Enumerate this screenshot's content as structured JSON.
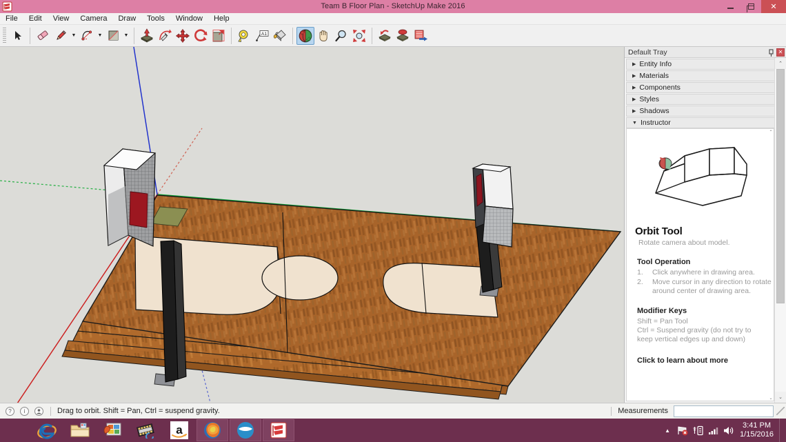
{
  "window": {
    "title": "Team B Floor Plan - SketchUp Make 2016",
    "app_icon": "sketchup-logo-icon",
    "minimize_label": "Minimize",
    "maximize_label": "Maximize",
    "close_label": "✕",
    "titlebar_color": "#dd7fa5",
    "close_color": "#cb5055"
  },
  "menubar": {
    "items": [
      {
        "label": "File"
      },
      {
        "label": "Edit"
      },
      {
        "label": "View"
      },
      {
        "label": "Camera"
      },
      {
        "label": "Draw"
      },
      {
        "label": "Tools"
      },
      {
        "label": "Window"
      },
      {
        "label": "Help"
      }
    ]
  },
  "toolbar": {
    "groups": [
      {
        "buttons": [
          {
            "name": "select-tool",
            "icon": "arrow-cursor-icon",
            "tooltip": "Select",
            "active": false,
            "dropdown": false
          }
        ]
      },
      {
        "buttons": [
          {
            "name": "eraser-tool",
            "icon": "eraser-icon",
            "tooltip": "Eraser",
            "active": false,
            "dropdown": false
          },
          {
            "name": "line-tool",
            "icon": "pencil-icon",
            "tooltip": "Line",
            "active": false,
            "dropdown": true
          },
          {
            "name": "arc-tool",
            "icon": "arc-icon",
            "tooltip": "Arc",
            "active": false,
            "dropdown": true
          },
          {
            "name": "rectangle-tool",
            "icon": "rectangle-icon",
            "tooltip": "Rectangle",
            "active": false,
            "dropdown": true
          }
        ]
      },
      {
        "buttons": [
          {
            "name": "pushpull-tool",
            "icon": "push-pull-icon",
            "tooltip": "Push/Pull",
            "active": false,
            "dropdown": false
          },
          {
            "name": "followme-tool",
            "icon": "follow-me-icon",
            "tooltip": "Follow Me",
            "active": false,
            "dropdown": false
          },
          {
            "name": "move-tool",
            "icon": "move-arrows-icon",
            "tooltip": "Move",
            "active": false,
            "dropdown": false
          },
          {
            "name": "rotate-tool",
            "icon": "rotate-icon",
            "tooltip": "Rotate",
            "active": false,
            "dropdown": false
          },
          {
            "name": "scale-tool",
            "icon": "scale-icon",
            "tooltip": "Scale",
            "active": false,
            "dropdown": false
          }
        ]
      },
      {
        "buttons": [
          {
            "name": "tape-measure-tool",
            "icon": "tape-measure-icon",
            "tooltip": "Tape Measure",
            "active": false,
            "dropdown": false
          },
          {
            "name": "text-tool",
            "icon": "text-a1-icon",
            "tooltip": "Text",
            "active": false,
            "dropdown": false
          },
          {
            "name": "paint-bucket-tool",
            "icon": "paint-bucket-icon",
            "tooltip": "Paint Bucket",
            "active": false,
            "dropdown": false
          }
        ]
      },
      {
        "buttons": [
          {
            "name": "orbit-tool",
            "icon": "orbit-icon",
            "tooltip": "Orbit",
            "active": true,
            "dropdown": false
          },
          {
            "name": "pan-tool",
            "icon": "hand-pan-icon",
            "tooltip": "Pan",
            "active": false,
            "dropdown": false
          },
          {
            "name": "zoom-tool",
            "icon": "magnifier-icon",
            "tooltip": "Zoom",
            "active": false,
            "dropdown": false
          },
          {
            "name": "zoom-extents-tool",
            "icon": "zoom-extents-icon",
            "tooltip": "Zoom Extents",
            "active": false,
            "dropdown": false
          }
        ]
      },
      {
        "buttons": [
          {
            "name": "previous-view-button",
            "icon": "previous-view-icon",
            "tooltip": "Previous",
            "active": false,
            "dropdown": false
          },
          {
            "name": "next-view-button",
            "icon": "next-view-icon",
            "tooltip": "Next",
            "active": false,
            "dropdown": false
          },
          {
            "name": "3d-warehouse-button",
            "icon": "warehouse-icon",
            "tooltip": "3D Warehouse",
            "active": false,
            "dropdown": false
          }
        ]
      }
    ]
  },
  "tray": {
    "title": "Default Tray",
    "pin_icon": "pin-icon",
    "close_label": "✕",
    "panels": [
      {
        "label": "Entity Info",
        "expanded": false,
        "close": "✕"
      },
      {
        "label": "Materials",
        "expanded": false,
        "close": "✕"
      },
      {
        "label": "Components",
        "expanded": false,
        "close": "✕"
      },
      {
        "label": "Styles",
        "expanded": false,
        "close": "✕"
      },
      {
        "label": "Shadows",
        "expanded": false,
        "close": "✕"
      },
      {
        "label": "Instructor",
        "expanded": true,
        "close": "✕"
      }
    ],
    "instructor": {
      "thumbnail_icon": "house-orbit-diagram-icon",
      "title": "Orbit Tool",
      "subtitle": "Rotate camera about model.",
      "operation_heading": "Tool Operation",
      "steps": [
        {
          "num": "1.",
          "text": "Click anywhere in drawing area."
        },
        {
          "num": "2.",
          "text": "Move cursor in any direction to rotate around center of drawing area."
        }
      ],
      "modifier_heading": "Modifier Keys",
      "modifier_lines": [
        "Shift = Pan Tool",
        "Ctrl = Suspend gravity (do not try to keep vertical edges up and down)"
      ],
      "learn_more": "Click to learn about more"
    },
    "scroll_up": "⌃",
    "scroll_down": "⌄"
  },
  "statusbar": {
    "icons": [
      {
        "name": "context-help-icon",
        "glyph": "?"
      },
      {
        "name": "info-icon",
        "glyph": "i"
      },
      {
        "name": "account-icon",
        "glyph": "●"
      }
    ],
    "message": "Drag to orbit. Shift = Pan, Ctrl = suspend gravity.",
    "measurements_label": "Measurements",
    "measurements_value": "",
    "measurements_placeholder": ""
  },
  "taskbar": {
    "start_icon": "windows-start-icon",
    "items": [
      {
        "name": "internet-explorer",
        "icon": "ie-icon",
        "running": false
      },
      {
        "name": "file-explorer",
        "icon": "folder-icon",
        "running": false
      },
      {
        "name": "photo-gallery",
        "icon": "photos-icon",
        "running": false
      },
      {
        "name": "movie-maker",
        "icon": "film-icon",
        "running": false
      },
      {
        "name": "amazon",
        "icon": "amazon-a-icon",
        "running": false
      },
      {
        "name": "firefox",
        "icon": "firefox-icon",
        "running": true
      },
      {
        "name": "openoffice",
        "icon": "openoffice-icon",
        "running": true
      },
      {
        "name": "sketchup",
        "icon": "sketchup-icon",
        "running": true
      }
    ],
    "tray_icons": [
      {
        "name": "show-hidden-icons",
        "glyph": "▲"
      },
      {
        "name": "network-warning-icon",
        "glyph": "flag"
      },
      {
        "name": "action-center-icon",
        "glyph": "center"
      },
      {
        "name": "signal-icon",
        "glyph": "bars"
      },
      {
        "name": "volume-icon",
        "glyph": "speaker"
      }
    ],
    "clock_time": "3:41 PM",
    "clock_date": "1/15/2016"
  },
  "canvas": {
    "background_color": "#dcdcd8",
    "model_name": "basketball-court-model",
    "axes": {
      "red_label": "red-axis",
      "green_label": "green-axis",
      "blue_label": "blue-axis",
      "red_color": "#cc2222",
      "green_color": "#11aa33",
      "blue_color": "#2233cc"
    },
    "floor_color": "#a8642a",
    "paint_color": "#f0e2cf",
    "court_elements": [
      "wood-floor",
      "left-key-area",
      "center-circle",
      "right-key-area",
      "left-hoop-assembly",
      "right-hoop-assembly",
      "bleacher-steps"
    ]
  }
}
